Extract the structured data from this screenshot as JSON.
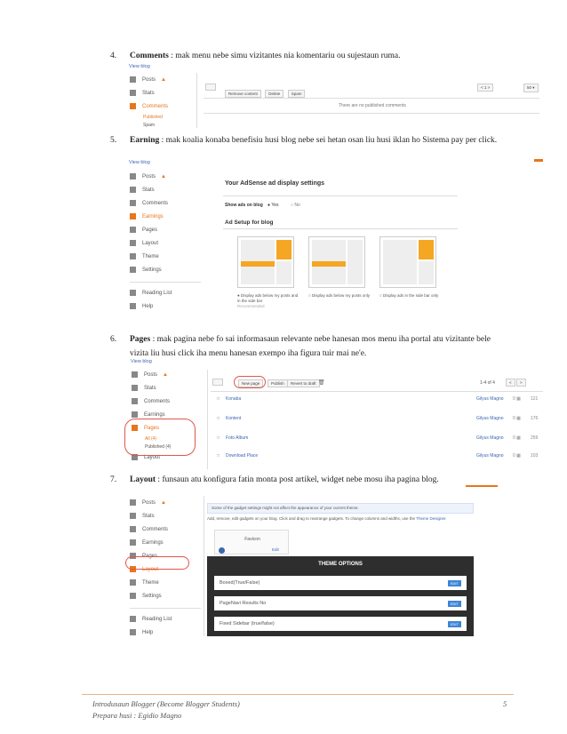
{
  "items": [
    {
      "num": "4.",
      "title": "Comments",
      "sep": " :",
      "text": " mak menu nebe simu vizitantes nia komentariu ou sujestaun ruma."
    },
    {
      "num": "5.",
      "title": "Earning",
      "sep": "  :",
      "text": " mak koalia konaba benefisiu husi blog nebe sei hetan osan liu husi iklan ho Sistema pay per click."
    },
    {
      "num": "6.",
      "title": "Pages",
      "sep": " :",
      "text": " mak pagina nebe fo sai informasaun relevante nebe hanesan mos menu iha portal atu vizitante bele vizita liu husi click iha menu hanesan exempo iha figura tuir mai ne'e."
    },
    {
      "num": "7.",
      "title": "Layout",
      "sep": " :",
      "text": " funsaun atu konfigura fatin monta  post artikel, widget nebe mosu iha pagina blog."
    }
  ],
  "shot1": {
    "view_blog": "View blog",
    "sidebar": [
      "Posts",
      "Stats",
      "Comments"
    ],
    "sub": [
      "Published",
      "Spam"
    ],
    "toolbar": [
      "Remove content",
      "Delete",
      "Spam"
    ],
    "empty": "There are no published comments",
    "nav": "< 1 >",
    "per": "50 ▾"
  },
  "shot2": {
    "view_blog": "View blog",
    "sidebar": [
      "Posts",
      "Stats",
      "Comments",
      "Earnings",
      "Pages",
      "Layout",
      "Theme",
      "Settings"
    ],
    "sidebar2": [
      "Reading List",
      "Help"
    ],
    "title": "Your AdSense ad display settings",
    "show_label": "Show ads on blog",
    "yes": "Yes",
    "no": "No",
    "setup": "Ad Setup for blog",
    "options": [
      "Display ads below my posts and in the side bar",
      "Display ads below my posts only",
      "Display ads in the side bar only"
    ],
    "recommended": "Recommended"
  },
  "shot3": {
    "view_blog": "View blog",
    "sidebar": [
      "Posts",
      "Stats",
      "Comments",
      "Earnings",
      "Pages",
      "Layout"
    ],
    "sub": [
      "All (4)",
      "Published (4)"
    ],
    "toolbar": [
      "New page",
      "Publish",
      "Revert to draft"
    ],
    "count": "1-4 of 4",
    "rows": [
      {
        "title": "Konaba",
        "author": "Gilyus Magno",
        "num": "121"
      },
      {
        "title": "Kontent",
        "author": "Gilyus Magno",
        "num": "176"
      },
      {
        "title": "Foto Album",
        "author": "Gilyus Magno",
        "num": "259"
      },
      {
        "title": "Download Place",
        "author": "Gilyus Magno",
        "num": "103"
      }
    ]
  },
  "shot4": {
    "sidebar": [
      "Posts",
      "Stats",
      "Comments",
      "Earnings",
      "Pages",
      "Layout",
      "Theme",
      "Settings"
    ],
    "sidebar2": [
      "Reading List",
      "Help"
    ],
    "notice": "Some of the gadget settings might not affect the appearance of your current theme.",
    "instructions": "Add, remove, edit gadgets on your blog. Click and drag to rearrange gadgets. To change columns and widths, use the ",
    "designer": "Theme Designer.",
    "favicon": "Favicon",
    "edit": "Edit",
    "theme_title": "THEME OPTIONS",
    "options": [
      "Boxed(True/False)",
      "PageNavi Results No",
      "Fixed Sidebar (true/false)"
    ],
    "edit_btn": "EDIT"
  },
  "footer": {
    "line1": "Introdusaun Blogger (Become Blogger Students)",
    "line2": "Prepara husi : Egidio Magno",
    "page": "5"
  }
}
